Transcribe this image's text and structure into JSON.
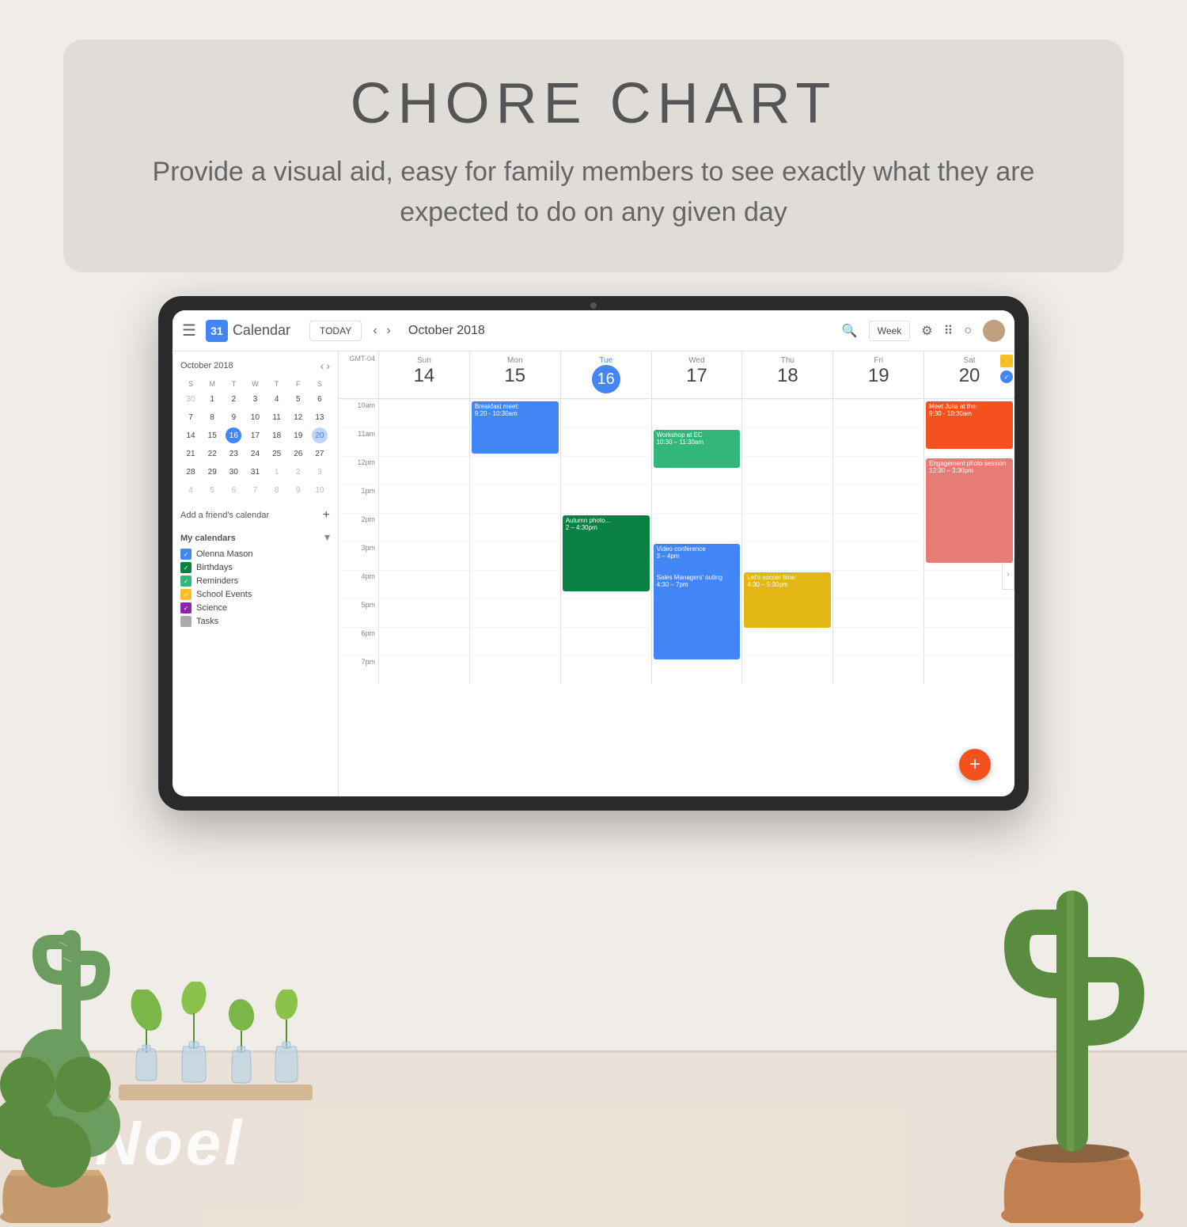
{
  "page": {
    "background": "#f0ede8"
  },
  "header": {
    "title": "CHORE CHART",
    "subtitle": "Provide a visual aid, easy for family members to see exactly what they are expected to do on any given day"
  },
  "calendar": {
    "app_name": "Calendar",
    "today_label": "TODAY",
    "month_title": "October 2018",
    "view_label": "Week",
    "timezone": "GMT-04",
    "logo_number": "31",
    "days": [
      {
        "name": "Sun",
        "number": "14"
      },
      {
        "name": "Mon",
        "number": "15"
      },
      {
        "name": "Tue",
        "number": "16",
        "today": true
      },
      {
        "name": "Wed",
        "number": "17"
      },
      {
        "name": "Thu",
        "number": "18"
      },
      {
        "name": "Fri",
        "number": "19"
      },
      {
        "name": "Sat",
        "number": "20"
      }
    ],
    "times": [
      "10am",
      "11am",
      "12pm",
      "1pm",
      "2pm",
      "3pm",
      "4pm",
      "5pm",
      "6pm",
      "7pm"
    ],
    "events": [
      {
        "title": "Breakfast meet: 9:20 - 10:30am",
        "day": 1,
        "startRow": 0,
        "height": 2,
        "color": "#4285f4"
      },
      {
        "title": "Workshop at EC 10:30 - 11:30am",
        "day": 3,
        "startRow": 1,
        "height": 1.5,
        "color": "#33b679"
      },
      {
        "title": "Meet Julia at the: 9:30 - 10:30am",
        "day": 6,
        "startRow": 0,
        "height": 2,
        "color": "#f4511e"
      },
      {
        "title": "Autumn photo... 2 - 4:30pm",
        "day": 2,
        "startRow": 4,
        "height": 3,
        "color": "#0b8043"
      },
      {
        "title": "Engagement photo session 12:30 - 3:30pm",
        "day": 6,
        "startRow": 3,
        "height": 4,
        "color": "#e67c73"
      },
      {
        "title": "Video conference 3 - 4pm",
        "day": 3,
        "startRow": 5,
        "height": 2,
        "color": "#4285f4"
      },
      {
        "title": "Sales Managers' outing 4:30 - 7pm",
        "day": 3,
        "startRow": 6,
        "height": 4,
        "color": "#4285f4"
      },
      {
        "title": "Let's soccer time: 4:30 - 5:30pm",
        "day": 4,
        "startRow": 6,
        "height": 2,
        "color": "#e2b714"
      }
    ],
    "sidebar": {
      "mini_cal_title": "October 2018",
      "days_of_week": [
        "S",
        "M",
        "T",
        "W",
        "T",
        "F",
        "S"
      ],
      "weeks": [
        [
          "30",
          "1",
          "2",
          "3",
          "4",
          "5",
          "6"
        ],
        [
          "7",
          "8",
          "9",
          "10",
          "11",
          "12",
          "13"
        ],
        [
          "14",
          "15",
          "16",
          "17",
          "18",
          "19",
          "20"
        ],
        [
          "21",
          "22",
          "23",
          "24",
          "25",
          "26",
          "27"
        ],
        [
          "28",
          "29",
          "30",
          "31",
          "1",
          "2",
          "3"
        ],
        [
          "4",
          "5",
          "6",
          "7",
          "8",
          "9",
          "10"
        ]
      ],
      "today_index": [
        2,
        2
      ],
      "add_friend": "Add a friend's calendar",
      "my_calendars_title": "My calendars",
      "my_calendars": [
        {
          "name": "Olenna Mason",
          "color": "#4285f4",
          "checked": true
        },
        {
          "name": "Birthdays",
          "color": "#0b8043",
          "checked": true
        },
        {
          "name": "Reminders",
          "color": "#33b679",
          "checked": true
        },
        {
          "name": "School Events",
          "color": "#f6bf26",
          "checked": true
        },
        {
          "name": "Science",
          "color": "#8e24aa",
          "checked": true
        },
        {
          "name": "Tasks",
          "color": "#aaa",
          "checked": false
        }
      ]
    }
  },
  "watermark": {
    "text": "Noel"
  },
  "icons": {
    "menu": "☰",
    "search": "🔍",
    "settings": "⚙",
    "apps": "⠿",
    "account": "○",
    "back": "‹",
    "forward": "›",
    "add": "+",
    "expand": "▾",
    "check": "✓",
    "fab_plus": "+"
  }
}
